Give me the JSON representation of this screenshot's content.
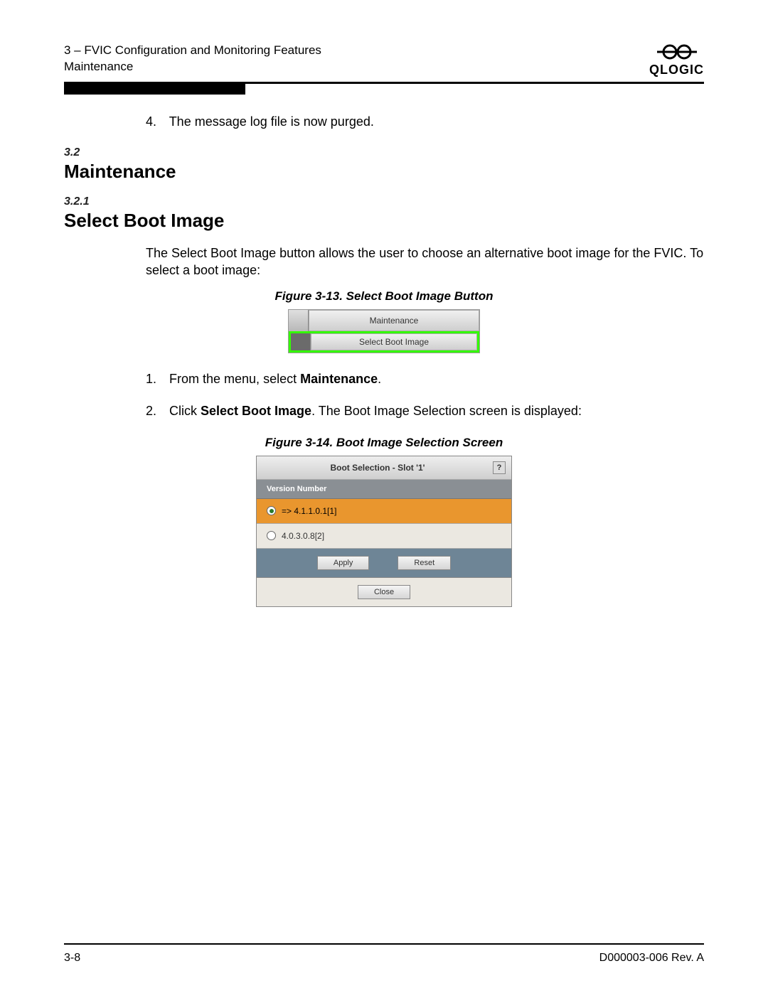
{
  "header": {
    "chapter": "3 – FVIC Configuration and Monitoring Features",
    "section": "Maintenance",
    "brand": "QLOGIC"
  },
  "intro_item": {
    "num": "4.",
    "text": "The message log file is now purged."
  },
  "sec32": {
    "num": "3.2",
    "title": "Maintenance"
  },
  "sec321": {
    "num": "3.2.1",
    "title": "Select Boot Image"
  },
  "para1": "The Select Boot Image button allows the user to choose an alternative boot image for the FVIC. To select a boot image:",
  "fig13": {
    "caption": "Figure 3-13. Select Boot Image Button",
    "row1": "Maintenance",
    "row2": "Select Boot Image"
  },
  "steps": {
    "s1": {
      "num": "1.",
      "pre": "From the menu, select ",
      "bold": "Maintenance",
      "post": "."
    },
    "s2": {
      "num": "2.",
      "pre": "Click ",
      "bold": "Select Boot Image",
      "post": ". The Boot Image Selection screen is displayed:"
    }
  },
  "fig14": {
    "caption": "Figure 3-14. Boot Image Selection Screen",
    "title": "Boot Selection - Slot '1'",
    "help": "?",
    "colhead": "Version Number",
    "row_sel": "=> 4.1.1.0.1[1]",
    "row_unsel": "4.0.3.0.8[2]",
    "apply": "Apply",
    "reset": "Reset",
    "close": "Close"
  },
  "footer": {
    "left": "3-8",
    "right": "D000003-006 Rev. A"
  }
}
